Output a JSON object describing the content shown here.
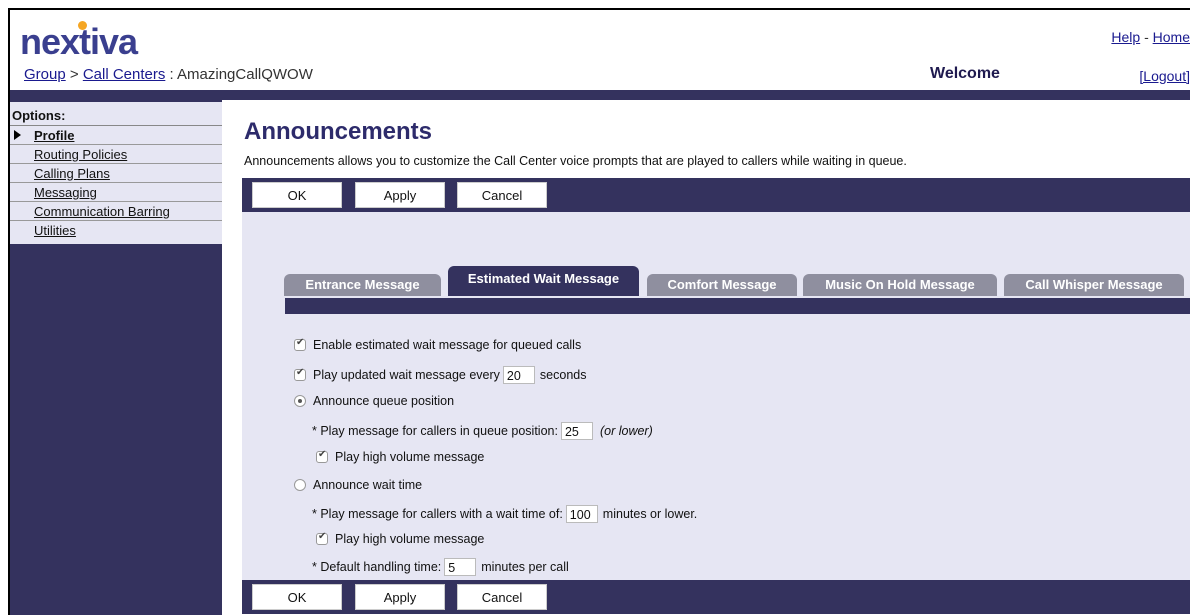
{
  "header": {
    "logo": "nextiva",
    "breadcrumb": {
      "group": "Group",
      "sep1": ">",
      "call_centers": "Call Centers",
      "sep2": ":",
      "name": "AmazingCallQWOW"
    },
    "help": "Help",
    "links_sep": "-",
    "home": "Home",
    "welcome": "Welcome",
    "logout": "[Logout]"
  },
  "sidebar": {
    "title": "Options:",
    "items": [
      {
        "label": "Profile",
        "active": true
      },
      {
        "label": "Routing Policies"
      },
      {
        "label": "Calling Plans"
      },
      {
        "label": "Messaging"
      },
      {
        "label": "Communication Barring"
      },
      {
        "label": "Utilities"
      }
    ]
  },
  "page": {
    "title": "Announcements",
    "description": "Announcements allows you to customize the Call Center voice prompts that are played to callers while waiting in queue."
  },
  "buttons": {
    "ok": "OK",
    "apply": "Apply",
    "cancel": "Cancel"
  },
  "tabs": [
    {
      "label": "Entrance Message"
    },
    {
      "label": "Estimated Wait Message",
      "active": true
    },
    {
      "label": "Comfort Message"
    },
    {
      "label": "Music On Hold Message"
    },
    {
      "label": "Call Whisper Message"
    }
  ],
  "form": {
    "enable_label": "Enable estimated wait message for queued calls",
    "play_updated_prefix": "Play updated wait message every",
    "play_updated_value": "20",
    "play_updated_suffix": "seconds",
    "announce_position_label": "Announce queue position",
    "position_prefix": "* Play message for callers in queue position:",
    "position_value": "25",
    "position_suffix": "(or lower)",
    "high_volume_1": "Play high volume message",
    "announce_wait_label": "Announce wait time",
    "wait_prefix": "* Play message for callers with a wait time of:",
    "wait_value": "100",
    "wait_suffix": "minutes or lower.",
    "high_volume_2": "Play high volume message",
    "handling_prefix": "* Default handling time:",
    "handling_value": "5",
    "handling_suffix": "minutes per call"
  },
  "colors": {
    "brand_navy": "#34325e",
    "logo_orange": "#f5a623",
    "panel": "#e6e6f3"
  }
}
